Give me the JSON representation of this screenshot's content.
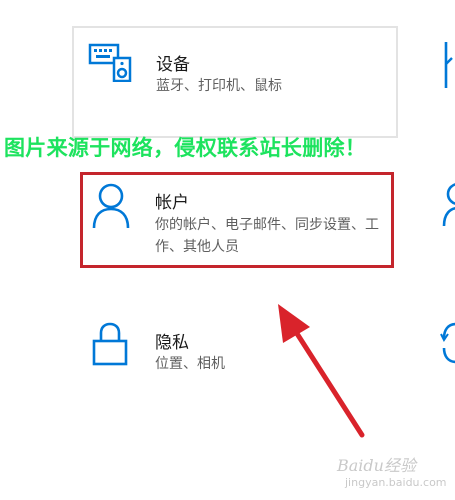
{
  "settings": {
    "tiles": [
      {
        "title": "设备",
        "desc": "蓝牙、打印机、鼠标",
        "icon": "keyboard-speaker-icon"
      },
      {
        "title": "帐户",
        "desc": "你的帐户、电子邮件、同步设置、工作、其他人员",
        "icon": "person-icon"
      },
      {
        "title": "隐私",
        "desc": "位置、相机",
        "icon": "lock-icon"
      }
    ]
  },
  "overlay": {
    "watermark": "图片来源于网络，侵权联系站长删除！",
    "logo": "Baidu经验",
    "logo_url": "jingyan.baidu.com"
  },
  "colors": {
    "accent": "#0078d7",
    "highlight_box": "#c4252c",
    "arrow": "#d9232b",
    "watermark": "#1de35e"
  }
}
